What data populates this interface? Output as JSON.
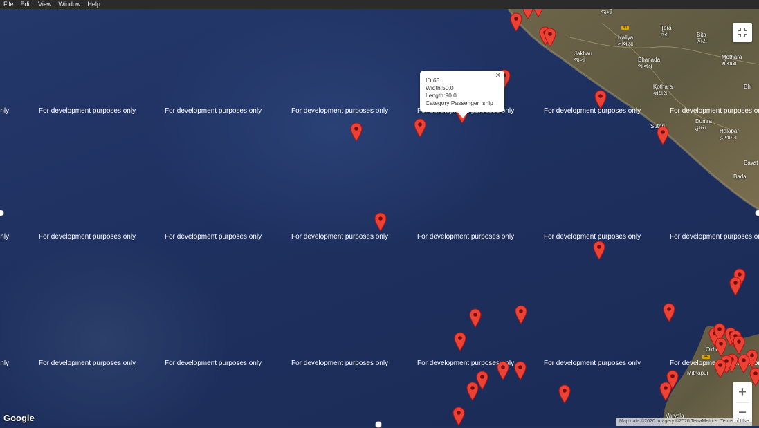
{
  "menu": {
    "items": [
      "File",
      "Edit",
      "View",
      "Window",
      "Help"
    ]
  },
  "watermark": {
    "text": "For development purposes only"
  },
  "info_window": {
    "id_line": "ID:63",
    "width_line": "Width:50.0",
    "length_line": "Length:90.0",
    "category_line": "Category:Passenger_ship",
    "close_glyph": "✕"
  },
  "controls": {
    "zoom_in": "+",
    "zoom_out": "−",
    "fullscreen_icon": "fullscreen-exit-icon"
  },
  "branding": {
    "logo": "Google"
  },
  "attribution": {
    "map_data": "Map data ©2020 Imagery ©2020 TerraMetrics",
    "terms": "Terms of Use"
  },
  "places": {
    "tera_en": "Tera",
    "tera_gu": "તેરા",
    "bita_en": "Bita",
    "bita_gu": "બિટા",
    "naliya_en": "Naliya",
    "naliya_gu": "નલિયા",
    "bhanada_en": "Bhanada",
    "bhanada_gu": "ભાનડા",
    "jakhau_en": "Jakhau",
    "jakhau_gu": "જખૌ",
    "kothara_en": "Kothara",
    "kothara_gu": "કોઠારા",
    "mothara_en": "Mothara",
    "mothara_gu": "મોથારા",
    "dumra_en": "Dumra",
    "dumra_gu": "ડુમરા",
    "halapar_en": "Halapar",
    "halapar_gu": "હાલાપર",
    "suthri": "Suthri",
    "bayat": "Bayat",
    "bada": "Bada",
    "okha": "Okha",
    "mithapur": "Mithapur",
    "varvala": "Varvala",
    "bhi": "Bhi",
    "road_41": "41",
    "road_4a": "4A"
  },
  "colors": {
    "marker_red": "#ea4335",
    "marker_dark": "#b31412",
    "marker_dot": "#7a0a0a",
    "land": "#6b6245",
    "water": "#1f2f5c"
  }
}
